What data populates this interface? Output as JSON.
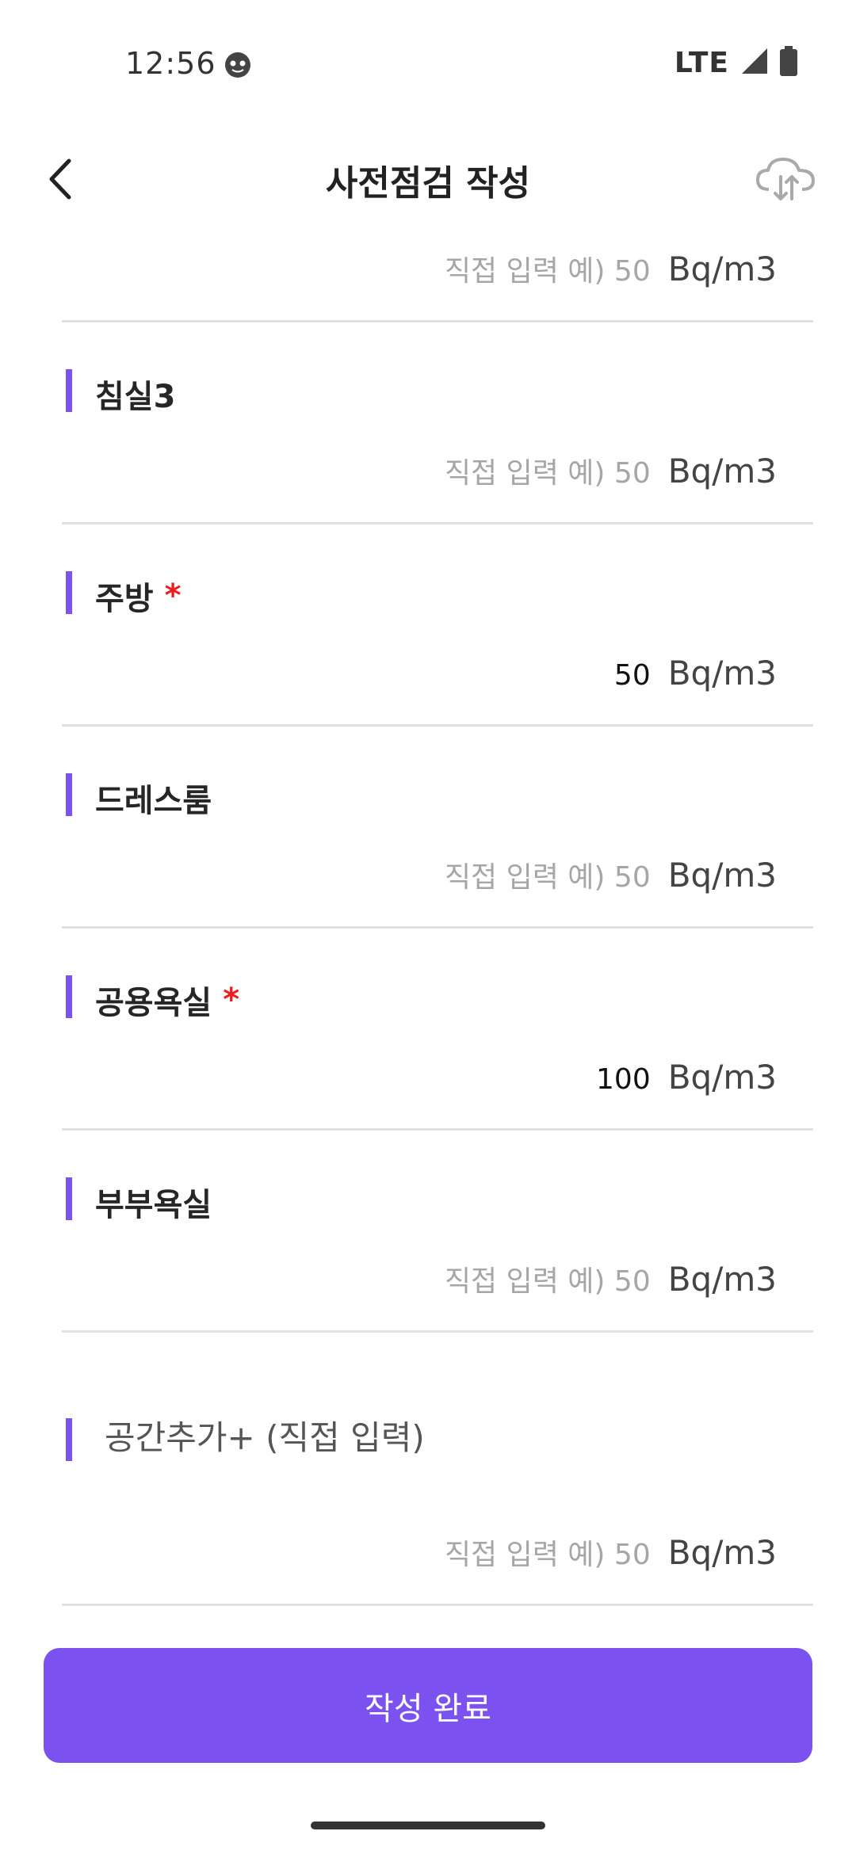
{
  "status_bar": {
    "time": "12:56",
    "network": "LTE"
  },
  "header": {
    "title": "사전점검 작성"
  },
  "form": {
    "unit": "Bq/m3",
    "placeholder": "직접 입력 예) 50",
    "top_row_value": "",
    "rooms": [
      {
        "label": "침실3",
        "required": false,
        "value": ""
      },
      {
        "label": "주방",
        "required": true,
        "value": "50"
      },
      {
        "label": "드레스룸",
        "required": false,
        "value": ""
      },
      {
        "label": "공용욕실",
        "required": true,
        "value": "100"
      },
      {
        "label": "부부욕실",
        "required": false,
        "value": ""
      }
    ],
    "required_mark": "*",
    "add_space": {
      "placeholder": "공간추가+ (직접 입력)",
      "value": ""
    }
  },
  "submit_label": "작성 완료",
  "colors": {
    "accent": "#7b52f0",
    "required": "#ee1c1c",
    "divider": "#e1e1e1"
  },
  "icons": {
    "back": "chevron-left-icon",
    "cloud": "cloud-sync-icon",
    "status_app": "app-notification-icon",
    "signal": "signal-icon",
    "battery": "battery-icon"
  }
}
